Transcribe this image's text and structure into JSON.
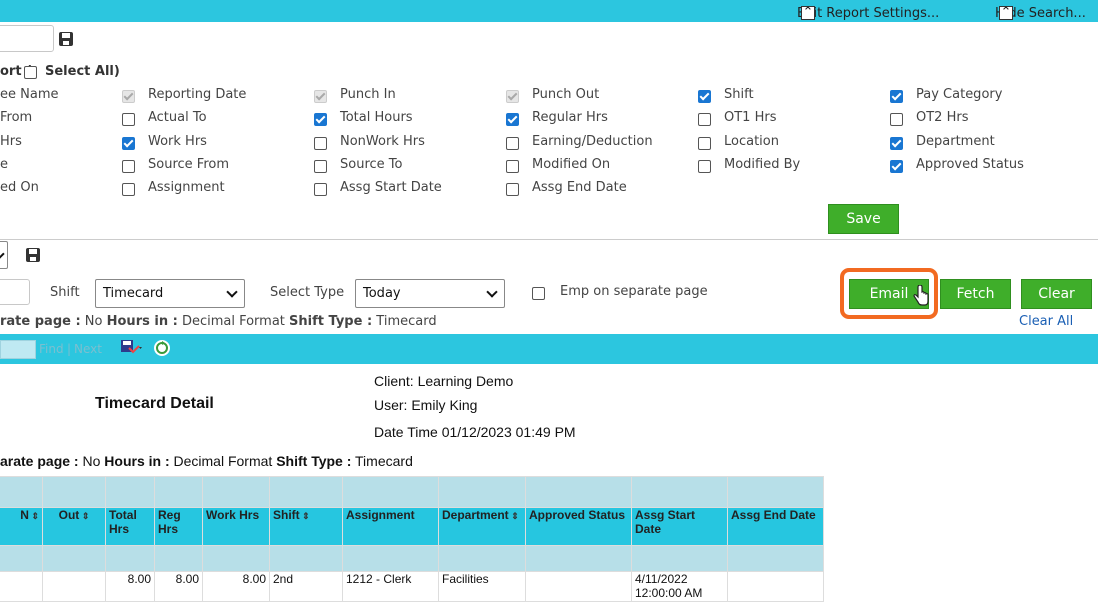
{
  "topbar": {
    "edit_settings": "Edit Report Settings...",
    "edit_icon": "double-chevron-up-icon",
    "hide_search": "Hide Search...",
    "hide_icon": "double-chevron-up-icon"
  },
  "columns_section": {
    "heading_prefix": "ort (",
    "select_all": "Select All)",
    "checkboxes": [
      {
        "label": "ee Name",
        "state": "none"
      },
      {
        "label": "Reporting Date",
        "state": "disabled"
      },
      {
        "label": "Punch In",
        "state": "disabled"
      },
      {
        "label": "Punch Out",
        "state": "disabled"
      },
      {
        "label": "Shift",
        "state": "checked"
      },
      {
        "label": "Pay Category",
        "state": "checked"
      },
      {
        "label": "From",
        "state": "none"
      },
      {
        "label": "Actual To",
        "state": "unchecked"
      },
      {
        "label": "Total Hours",
        "state": "checked"
      },
      {
        "label": "Regular Hrs",
        "state": "checked"
      },
      {
        "label": "OT1 Hrs",
        "state": "unchecked"
      },
      {
        "label": "OT2 Hrs",
        "state": "unchecked"
      },
      {
        "label": "Hrs",
        "state": "none"
      },
      {
        "label": "Work Hrs",
        "state": "checked"
      },
      {
        "label": "NonWork Hrs",
        "state": "unchecked"
      },
      {
        "label": "Earning/Deduction",
        "state": "unchecked"
      },
      {
        "label": "Location",
        "state": "unchecked"
      },
      {
        "label": "Department",
        "state": "checked"
      },
      {
        "label": "e",
        "state": "none"
      },
      {
        "label": "Source From",
        "state": "unchecked"
      },
      {
        "label": "Source To",
        "state": "unchecked"
      },
      {
        "label": "Modified On",
        "state": "unchecked"
      },
      {
        "label": "Modified By",
        "state": "unchecked"
      },
      {
        "label": "Approved Status",
        "state": "checked"
      },
      {
        "label": "ed On",
        "state": "none"
      },
      {
        "label": "Assignment",
        "state": "unchecked"
      },
      {
        "label": "Assg Start Date",
        "state": "unchecked"
      },
      {
        "label": "Assg End Date",
        "state": "unchecked"
      }
    ],
    "save_label": "Save"
  },
  "filters": {
    "shift_label": "Shift",
    "shift_value": "Timecard",
    "select_type_label": "Select Type",
    "select_type_value": "Today",
    "emp_separate_label": "Emp on separate page",
    "email_label": "Email",
    "fetch_label": "Fetch",
    "clear_label": "Clear",
    "clear_all_label": "Clear All",
    "summary": {
      "p1": "rate page :",
      "v1": " No ",
      "p2": "Hours in :",
      "v2": " Decimal Format ",
      "p3": "Shift Type :",
      "v3": " Timecard"
    }
  },
  "viewer_toolbar": {
    "find": "Find",
    "sep": "|",
    "next": "Next",
    "export_icon": "floppy-export-icon",
    "refresh_icon": "refresh-icon"
  },
  "report": {
    "title": "Timecard Detail",
    "client": "Client: Learning Demo",
    "user": "User: Emily King",
    "datetime": "Date Time 01/12/2023 01:49 PM",
    "summary": {
      "p1": "arate page :",
      "v1": " No ",
      "p2": "Hours in :",
      "v2": " Decimal Format ",
      "p3": "Shift Type :",
      "v3": " Timecard"
    },
    "headers": [
      "N",
      "Out",
      "Total Hrs",
      "Reg Hrs",
      "Work Hrs",
      "Shift",
      "Assignment",
      "Department",
      "Approved Status",
      "Assg Start Date",
      "Assg End Date"
    ],
    "row": [
      "",
      "",
      "8.00",
      "8.00",
      "8.00",
      "2nd",
      "1212 - Clerk",
      "Facilities",
      "",
      "4/11/2022 12:00:00 AM",
      ""
    ]
  },
  "colors": {
    "accent": "#2cc6df",
    "button_green": "#3fae2a",
    "highlight": "#f26a21",
    "checkbox_blue": "#1976d2",
    "link_blue": "#1a5fb4"
  }
}
